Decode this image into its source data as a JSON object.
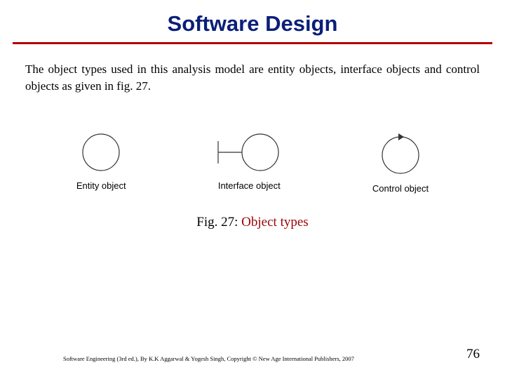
{
  "title": "Software Design",
  "body": "The object types used in this analysis model are entity objects, interface objects and control objects as given in fig. 27.",
  "figure": {
    "labels": {
      "entity": "Entity object",
      "interface": "Interface object",
      "control": "Control object"
    },
    "caption_prefix": "Fig. 27: ",
    "caption_main": "Object types"
  },
  "footer": "Software Engineering (3rd ed.), By K.K Aggarwal & Yogesh Singh, Copyright © New Age International Publishers, 2007",
  "page_number": "76"
}
